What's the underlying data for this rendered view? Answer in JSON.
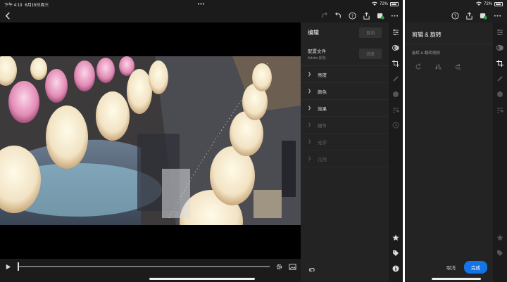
{
  "status": {
    "time": "下午 4:13",
    "date": "6月15日周三",
    "battery": "72%"
  },
  "panel": {
    "title": "编辑",
    "auto_label": "自动",
    "profile_label": "配置文件",
    "profile_value": "Adobe 颜色",
    "browse_label": "浏览",
    "sections": [
      {
        "label": "亮度"
      },
      {
        "label": "颜色"
      },
      {
        "label": "效果"
      },
      {
        "label": "细节"
      },
      {
        "label": "光学"
      },
      {
        "label": "几何"
      }
    ]
  },
  "crop_panel": {
    "title": "剪辑 & 旋转",
    "subtitle": "旋转 & 翻转视频",
    "cancel_label": "取消",
    "done_label": "完成"
  },
  "colors": {
    "accent": "#1473e6",
    "panel_bg": "#232323",
    "app_bg": "#1b1b1b"
  },
  "icons": {
    "back": "chevron-left-icon",
    "redo": "redo-icon",
    "undo": "undo-icon",
    "help": "help-icon",
    "share": "share-icon",
    "cloud": "cloud-sync-icon",
    "more": "more-icon"
  }
}
